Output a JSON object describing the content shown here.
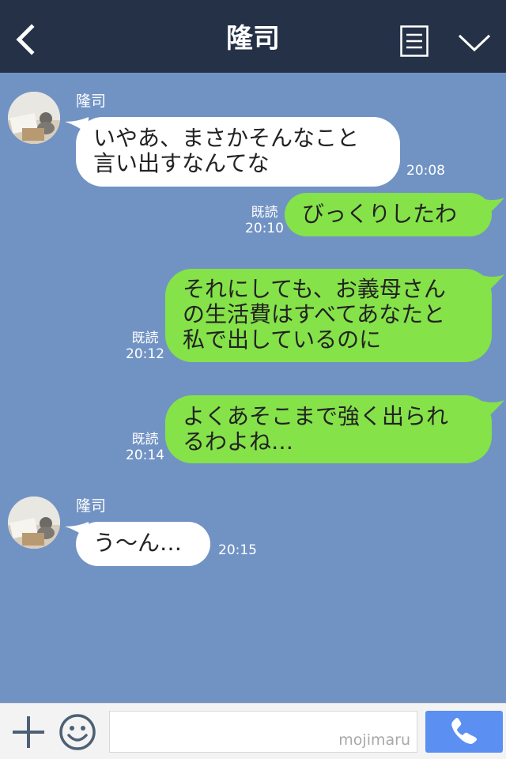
{
  "header": {
    "title": "隆司",
    "icons": {
      "back": "chevron-left-icon",
      "menu": "document-list-icon",
      "expand": "chevron-down-icon"
    }
  },
  "messages": [
    {
      "side": "incoming",
      "sender": "隆司",
      "lines": [
        "いやあ、まさかそんなこと",
        "言い出すなんてな"
      ],
      "time": "20:08"
    },
    {
      "side": "outgoing",
      "read": "既読",
      "lines": [
        "びっくりしたわ"
      ],
      "time": "20:10"
    },
    {
      "side": "outgoing",
      "read": "既読",
      "lines": [
        "それにしても、お義母さん",
        "の生活費はすべてあなたと",
        "私で出しているのに"
      ],
      "time": "20:12"
    },
    {
      "side": "outgoing",
      "read": "既読",
      "lines": [
        "よくあそこまで強く出られ",
        "るわよね…"
      ],
      "time": "20:14"
    },
    {
      "side": "incoming",
      "sender": "隆司",
      "lines": [
        "う〜ん…"
      ],
      "time": "20:15"
    }
  ],
  "footer": {
    "input_value": "",
    "watermark": "mojimaru",
    "icons": {
      "add": "plus-icon",
      "emoji": "smiley-icon",
      "call": "phone-icon"
    }
  },
  "colors": {
    "header_bg": "#253147",
    "chat_bg": "#7193c4",
    "incoming_bubble": "#ffffff",
    "outgoing_bubble": "#85e249",
    "call_button": "#5b8ff2"
  }
}
